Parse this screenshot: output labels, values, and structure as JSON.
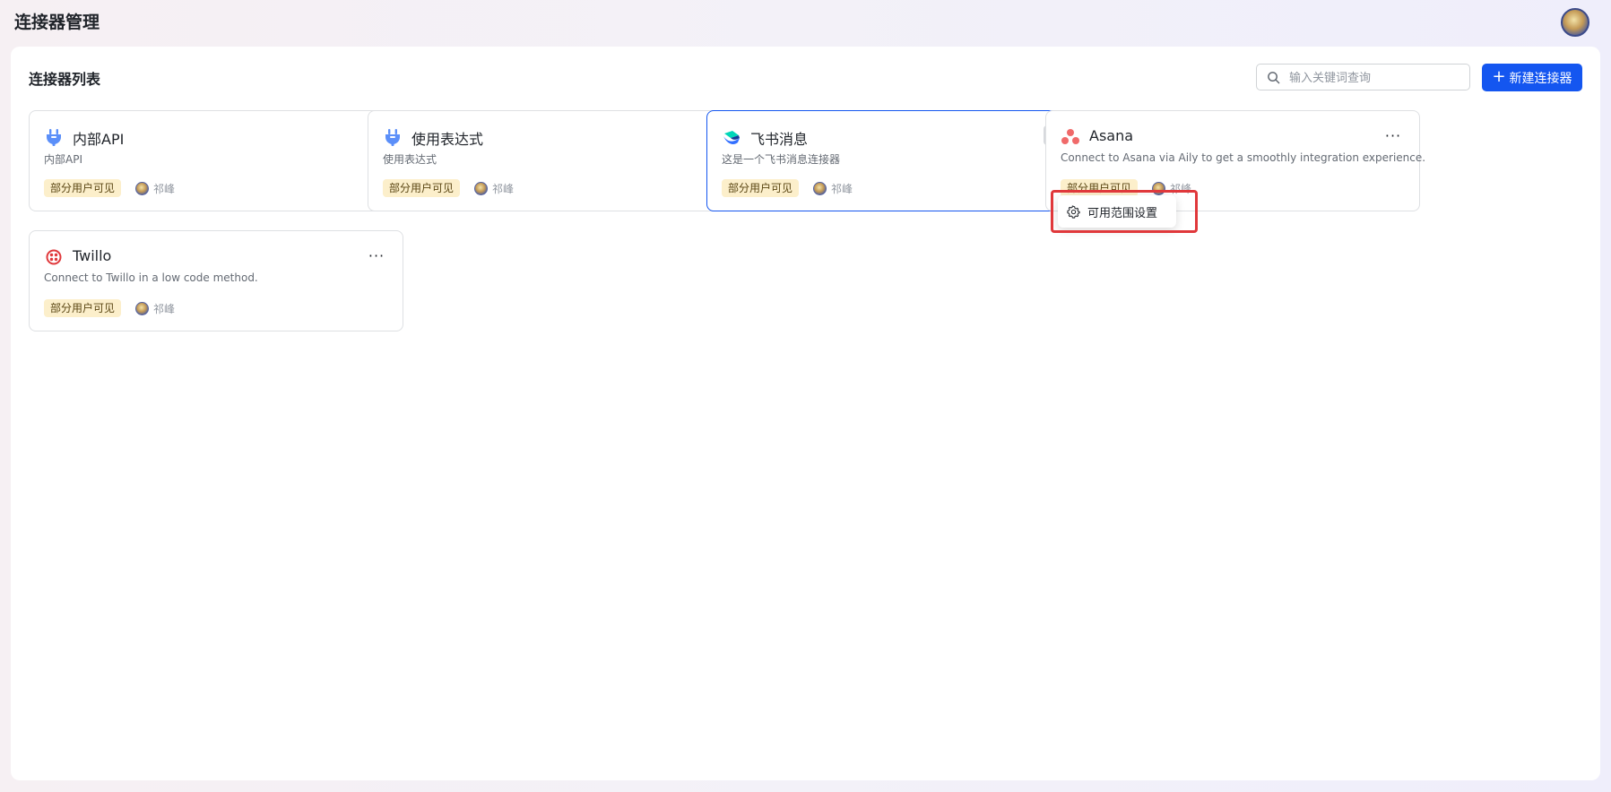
{
  "app": {
    "title": "连接器管理"
  },
  "panel": {
    "title": "连接器列表",
    "search_placeholder": "输入关键词查询",
    "new_button_label": "新建连接器"
  },
  "cards": [
    {
      "name": "内部API",
      "desc": "内部API",
      "tag": "部分用户可见",
      "owner": "祁峰",
      "icon": "plug-icon"
    },
    {
      "name": "使用表达式",
      "desc": "使用表达式",
      "tag": "部分用户可见",
      "owner": "祁峰",
      "icon": "plug-icon"
    },
    {
      "name": "飞书消息",
      "desc": "这是一个飞书消息连接器",
      "tag": "部分用户可见",
      "owner": "祁峰",
      "icon": "feishu-logo-icon"
    },
    {
      "name": "Asana",
      "desc": "Connect to Asana via Aily to get a smoothly integration experience.",
      "tag": "部分用户可见",
      "owner": "祁峰",
      "icon": "asana-logo-icon"
    },
    {
      "name": "Twillo",
      "desc": "Connect to Twillo in a low code method.",
      "tag": "部分用户可见",
      "owner": "祁峰",
      "icon": "twilio-logo-icon"
    }
  ],
  "more_label": "···",
  "popover": {
    "item_label": "可用范围设置",
    "icon": "gear-icon"
  },
  "colors": {
    "primary": "#1456f0",
    "tag_bg": "#fcefcb",
    "highlight": "#e0383b"
  }
}
